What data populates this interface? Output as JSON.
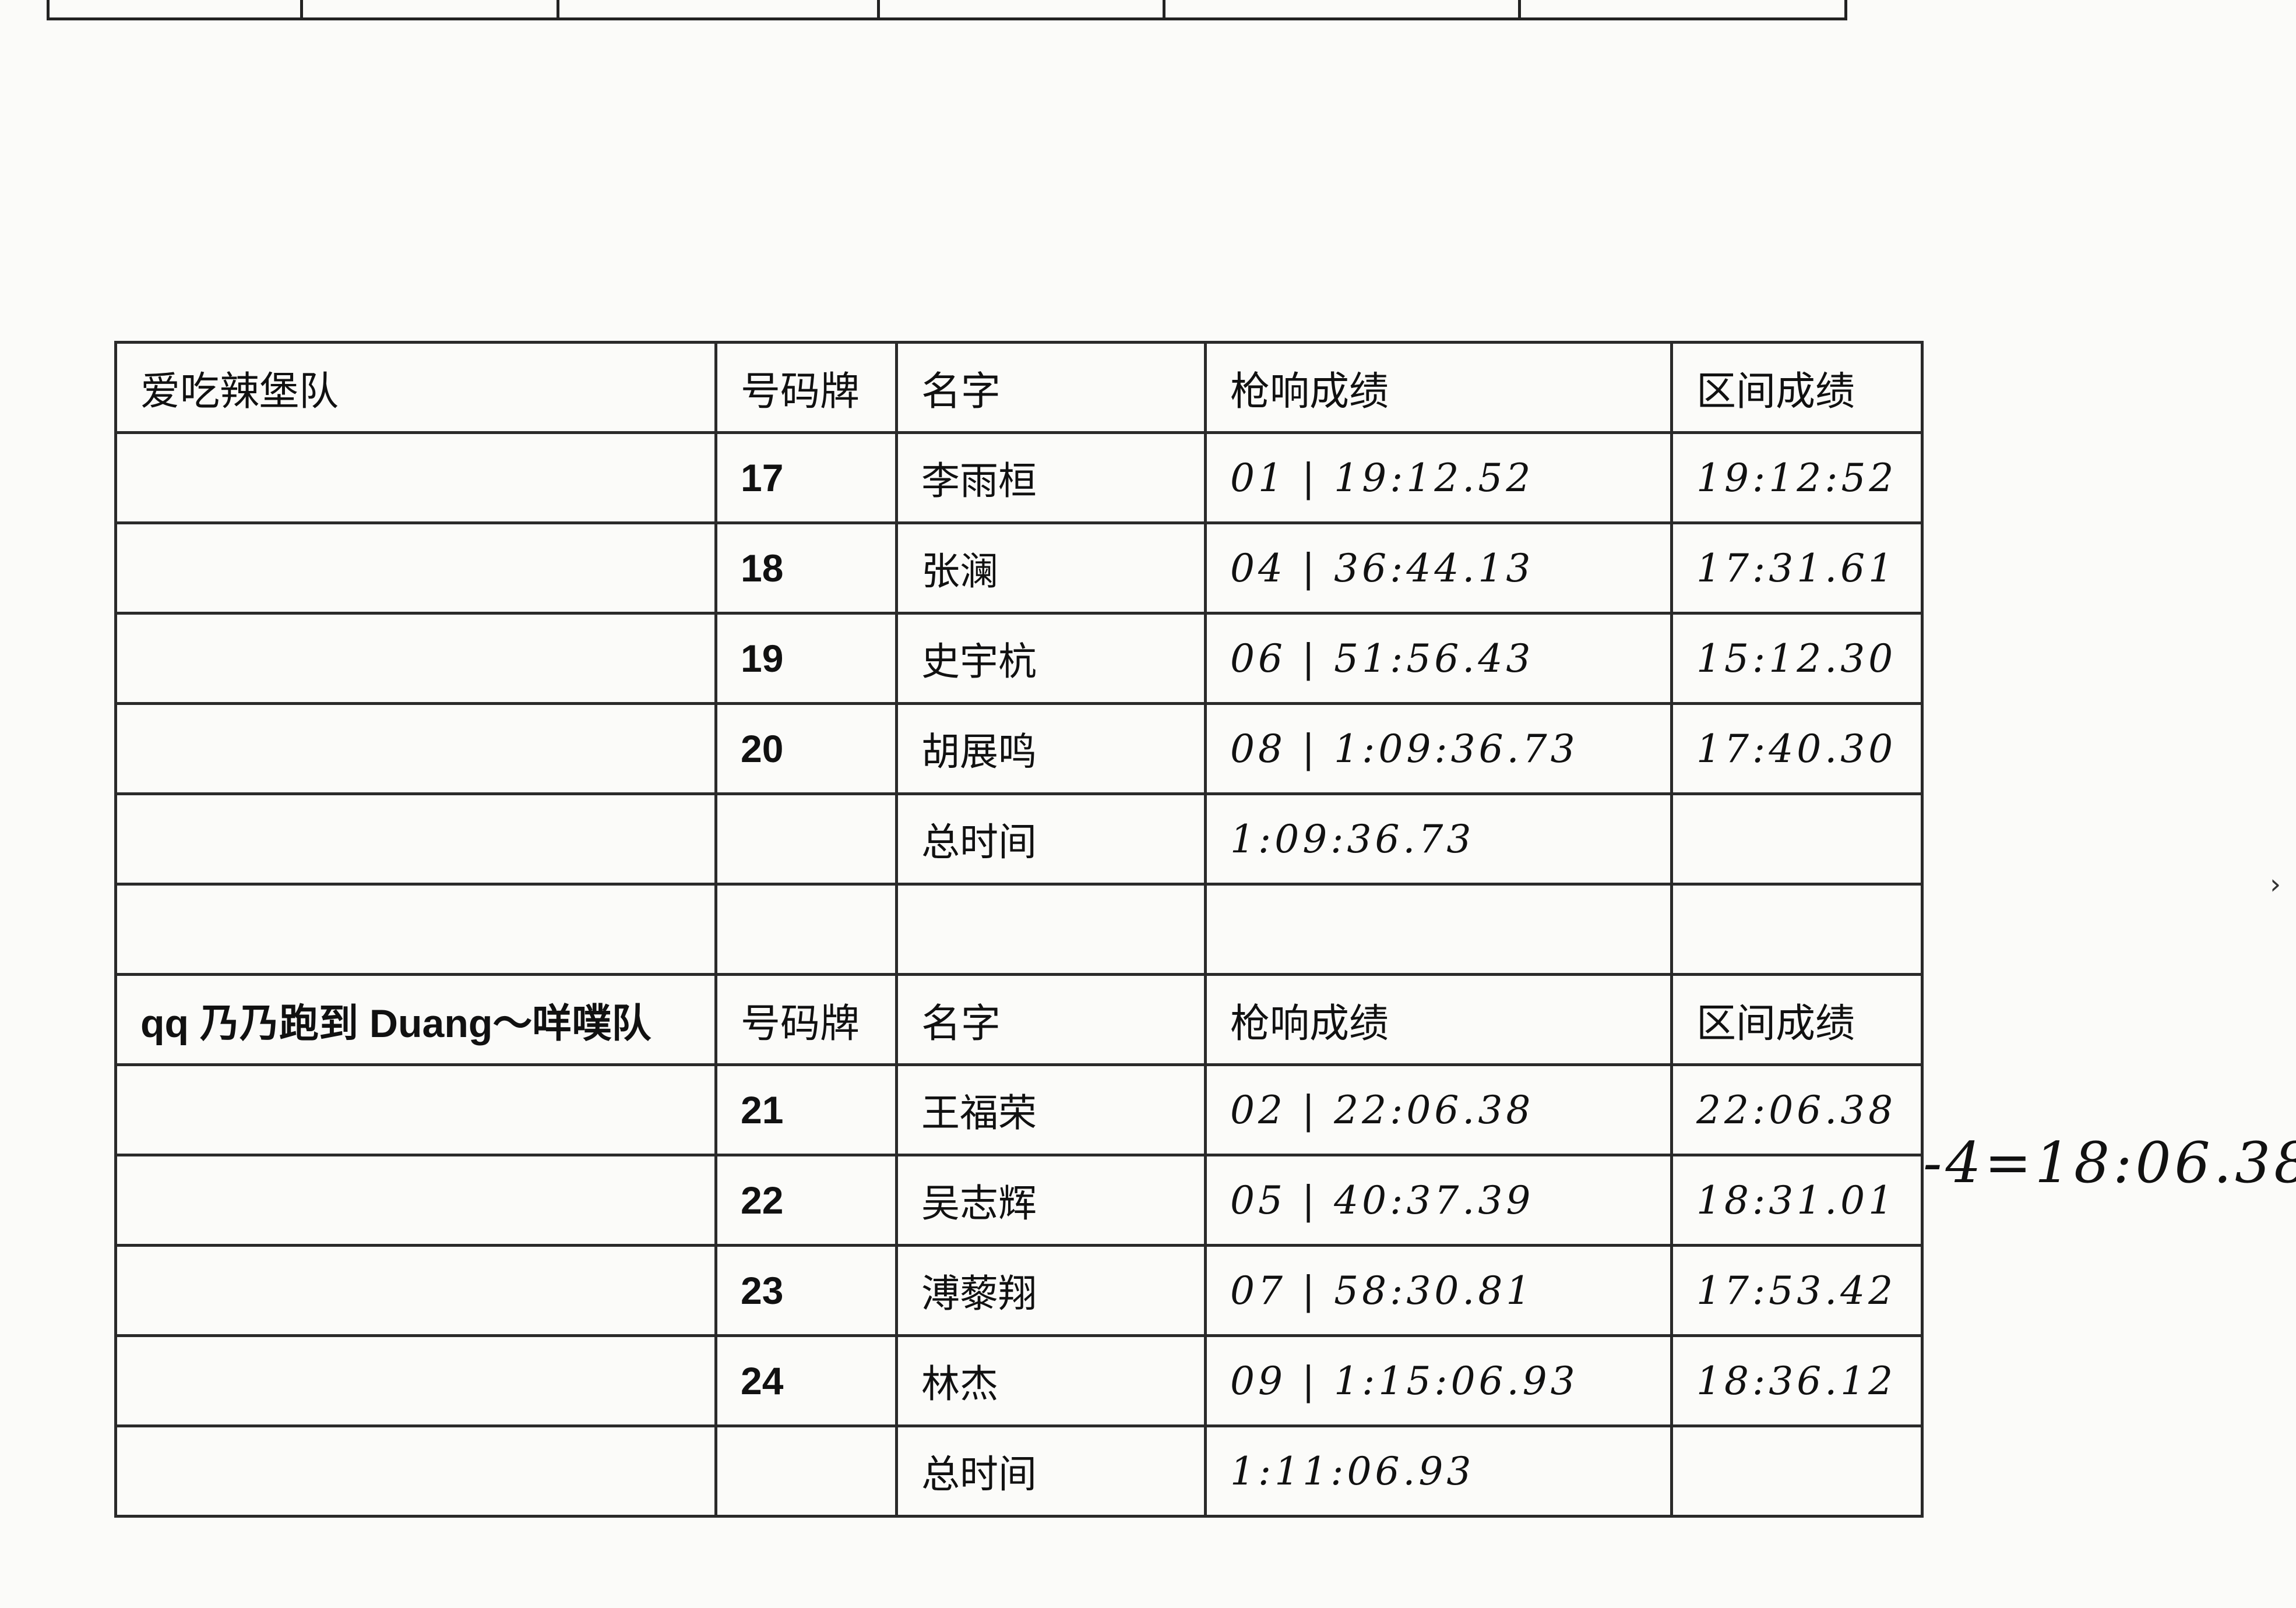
{
  "top_strip_text": "",
  "team1": {
    "name": "爱吃辣堡队",
    "headers": [
      "号码牌",
      "名字",
      "枪响成绩",
      "区间成绩"
    ],
    "rows": [
      {
        "bib": "17",
        "name": "李雨桓",
        "gun": "01 | 19:12.52",
        "split": "19:12:52"
      },
      {
        "bib": "18",
        "name": "张澜",
        "gun": "04 | 36:44.13",
        "split": "17:31.61"
      },
      {
        "bib": "19",
        "name": "史宇杭",
        "gun": "06 | 51:56.43",
        "split": "15:12.30"
      },
      {
        "bib": "20",
        "name": "胡展鸣",
        "gun": "08 | 1:09:36.73",
        "split": "17:40.30"
      }
    ],
    "total_label": "总时间",
    "total": "1:09:36.73"
  },
  "team2": {
    "name": "qq 乃乃跑到 Duang～咩噗队",
    "headers": [
      "号码牌",
      "名字",
      "枪响成绩",
      "区间成绩"
    ],
    "rows": [
      {
        "bib": "21",
        "name": "王福荣",
        "gun": "02 | 22:06.38",
        "split": "22:06.38"
      },
      {
        "bib": "22",
        "name": "吴志辉",
        "gun": "05 | 40:37.39",
        "split": "18:31.01"
      },
      {
        "bib": "23",
        "name": "溥藜翔",
        "gun": "07 | 58:30.81",
        "split": "17:53.42"
      },
      {
        "bib": "24",
        "name": "林杰",
        "gun": "09 | 1:15:06.93",
        "split": "18:36.12"
      }
    ],
    "total_label": "总时间",
    "total": "1:11:06.93"
  },
  "side_note": "-4=18:06.38",
  "chevron": "›"
}
